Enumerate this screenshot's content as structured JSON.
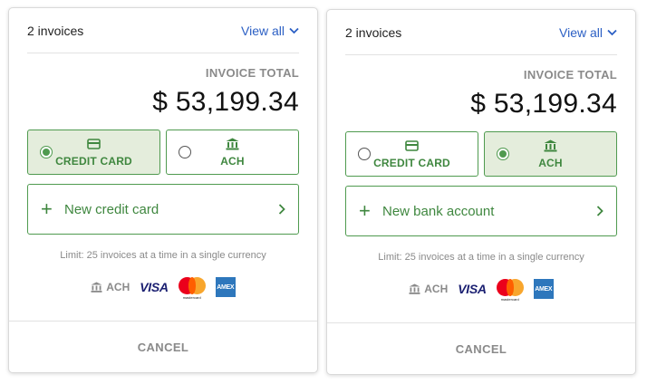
{
  "colors": {
    "accent_green": "#4f9a4f",
    "selected_bg": "#e4eddc",
    "link_blue": "#2b5fc4",
    "muted_gray": "#8a8a8a"
  },
  "panels": [
    {
      "invoice_count": "2 invoices",
      "view_all": "View all",
      "total_label": "INVOICE TOTAL",
      "total_amount": "$ 53,199.34",
      "methods": [
        {
          "label": "CREDIT CARD",
          "icon": "credit-card-icon",
          "selected": true
        },
        {
          "label": "ACH",
          "icon": "bank-icon",
          "selected": false
        }
      ],
      "new_item": {
        "plus": "+",
        "label": "New credit card"
      },
      "limit_text": "Limit: 25 invoices at a time in a single currency",
      "logos": {
        "ach": "ACH",
        "visa": "VISA",
        "mastercard": "mastercard",
        "amex": "AMEX"
      },
      "cancel": "CANCEL"
    },
    {
      "invoice_count": "2 invoices",
      "view_all": "View all",
      "total_label": "INVOICE TOTAL",
      "total_amount": "$ 53,199.34",
      "methods": [
        {
          "label": "CREDIT CARD",
          "icon": "credit-card-icon",
          "selected": false
        },
        {
          "label": "ACH",
          "icon": "bank-icon",
          "selected": true
        }
      ],
      "new_item": {
        "plus": "+",
        "label": "New bank account"
      },
      "limit_text": "Limit: 25 invoices at a time in a single currency",
      "logos": {
        "ach": "ACH",
        "visa": "VISA",
        "mastercard": "mastercard",
        "amex": "AMEX"
      },
      "cancel": "CANCEL"
    }
  ]
}
